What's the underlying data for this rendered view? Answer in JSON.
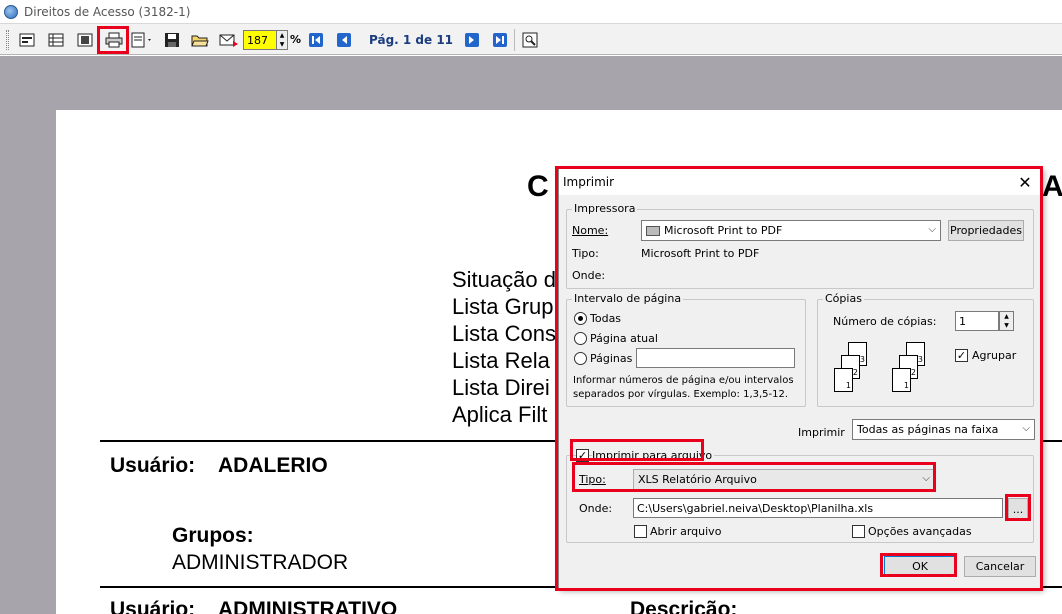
{
  "window": {
    "title": "Direitos de Acesso (3182-1)"
  },
  "toolbar": {
    "zoom_value": "187",
    "zoom_suffix": "%",
    "page_label": "Pág. 1 de 11",
    "icons": [
      "view-icon",
      "grid-icon",
      "fit-icon",
      "printer-icon",
      "export-icon",
      "save-icon",
      "open-folder-icon",
      "mail-icon",
      "first-page-icon",
      "prev-page-icon",
      "next-page-icon",
      "last-page-icon",
      "search-icon"
    ]
  },
  "report": {
    "title_fragment": "C",
    "title_fragment_right": "AC",
    "filter_lines": [
      "Situação d",
      "Lista Grup",
      "Lista Cons",
      "Lista Rela",
      "Lista Direi",
      "Aplica Filt"
    ],
    "user1_label": "Usuário:",
    "user1_name": "ADALERIO",
    "groups_label": "Grupos:",
    "group_name": "ADMINISTRADOR",
    "user2_label": "Usuário:",
    "user2_name": "ADMINISTRATIVO",
    "descricao_label": "Descrição:"
  },
  "dialog": {
    "title": "Imprimir",
    "printer_group": "Impressora",
    "name_label": "Nome:",
    "printer_name": "Microsoft Print to PDF",
    "properties_button": "Propriedades",
    "type_label": "Tipo:",
    "type_value": "Microsoft Print to PDF",
    "where_label": "Onde:",
    "range_group": "Intervalo de página",
    "range_all": "Todas",
    "range_current": "Página atual",
    "range_pages": "Páginas",
    "range_hint_1": "Informar números de página e/ou intervalos",
    "range_hint_2": "separados por vírgulas. Exemplo: 1,3,5-12.",
    "copies_group": "Cópias",
    "copies_label": "Número de cópias:",
    "copies_value": "1",
    "collate_label": "Agrupar",
    "print_label": "Imprimir",
    "print_select": "Todas as páginas na faixa",
    "print_to_file_label": "Imprimir para arquivo",
    "file_type_label": "Tipo:",
    "file_type_value": "XLS Relatório Arquivo",
    "file_where_label": "Onde:",
    "file_path": "C:\\Users\\gabriel.neiva\\Desktop\\Planilha.xls",
    "browse_button": "...",
    "open_file_label": "Abrir arquivo",
    "advanced_label": "Opções avançadas",
    "ok_button": "OK",
    "cancel_button": "Cancelar"
  },
  "colors": {
    "highlight": "#e8001c",
    "zoom_bg": "#ffff00",
    "viewer_bg": "#a7a5ab",
    "nav_blue": "#2266cc"
  }
}
